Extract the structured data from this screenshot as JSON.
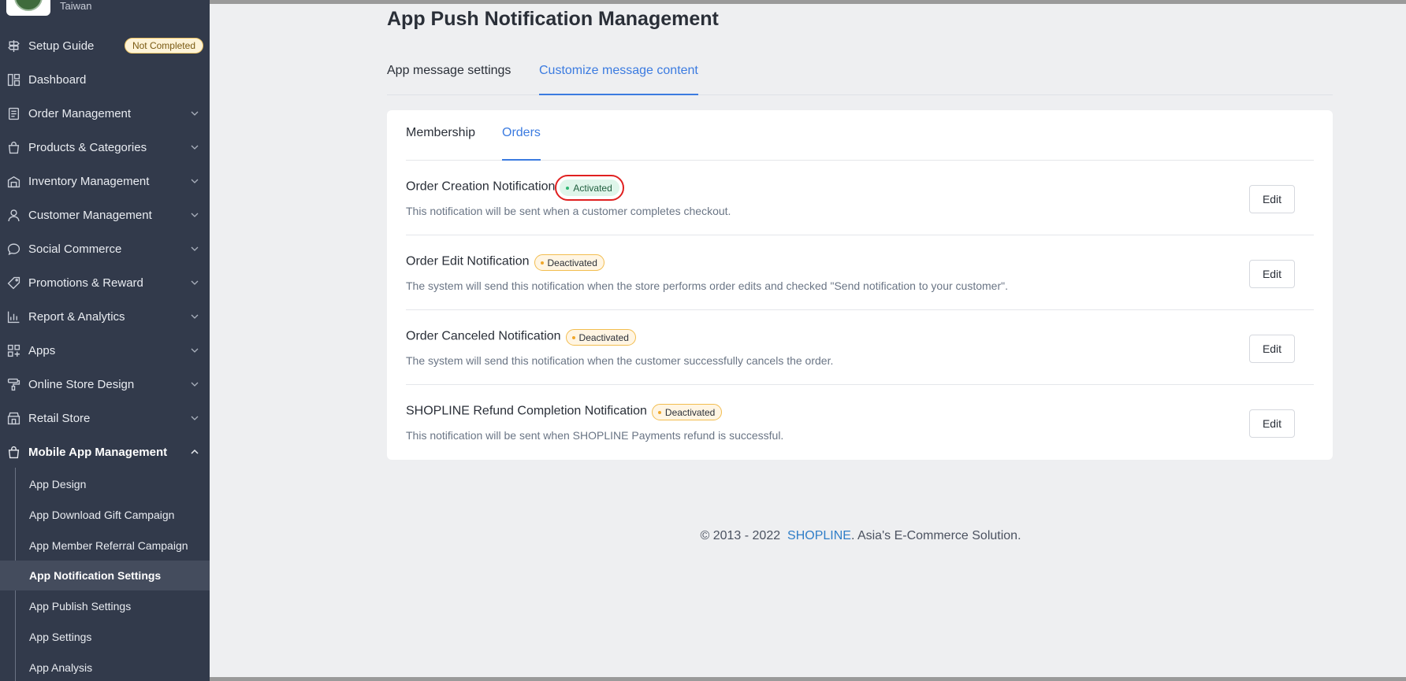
{
  "sidebar": {
    "store_region": "Taiwan",
    "setup_guide": {
      "label": "Setup Guide",
      "badge": "Not Completed"
    },
    "items": [
      {
        "label": "Dashboard",
        "icon": "dashboard-icon"
      },
      {
        "label": "Order Management",
        "icon": "document-icon"
      },
      {
        "label": "Products & Categories",
        "icon": "bag-icon"
      },
      {
        "label": "Inventory Management",
        "icon": "warehouse-icon"
      },
      {
        "label": "Customer Management",
        "icon": "user-icon"
      },
      {
        "label": "Social Commerce",
        "icon": "chat-icon"
      },
      {
        "label": "Promotions & Reward",
        "icon": "tag-icon"
      },
      {
        "label": "Report & Analytics",
        "icon": "chart-icon"
      },
      {
        "label": "Apps",
        "icon": "apps-icon"
      },
      {
        "label": "Online Store Design",
        "icon": "paint-roller-icon"
      },
      {
        "label": "Retail Store",
        "icon": "store-icon"
      },
      {
        "label": "Mobile App Management",
        "icon": "bag-icon"
      }
    ],
    "sub_items": [
      "App Design",
      "App Download Gift Campaign",
      "App Member Referral Campaign",
      "App Notification Settings",
      "App Publish Settings",
      "App Settings",
      "App Analysis"
    ]
  },
  "page": {
    "title": "App Push Notification Management",
    "tabs": [
      "App message settings",
      "Customize message content"
    ],
    "inner_tabs": [
      "Membership",
      "Orders"
    ],
    "notifications": [
      {
        "title": "Order Creation Notification",
        "status": "Activated",
        "description": "This notification will be sent when a customer completes checkout.",
        "action": "Edit"
      },
      {
        "title": "Order Edit Notification",
        "status": "Deactivated",
        "description": "The system will send this notification when the store performs order edits and checked \"Send notification to your customer\".",
        "action": "Edit"
      },
      {
        "title": "Order Canceled Notification",
        "status": "Deactivated",
        "description": "The system will send this notification when the customer successfully cancels the order.",
        "action": "Edit"
      },
      {
        "title": "SHOPLINE Refund Completion Notification",
        "status": "Deactivated",
        "description": "This notification will be sent when SHOPLINE Payments refund is successful.",
        "action": "Edit"
      }
    ]
  },
  "footer": {
    "prefix": "© 2013 - 2022",
    "brand": "SHOPLINE",
    "suffix": ". Asia's E-Commerce Solution."
  },
  "colors": {
    "sidebar_bg": "#323a4b",
    "accent": "#3b7be0",
    "active_green": "#2fb673",
    "inactive_orange": "#f0a72a",
    "highlight_red": "#e02020"
  }
}
